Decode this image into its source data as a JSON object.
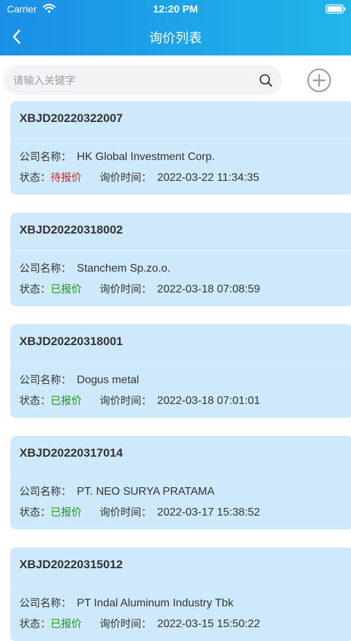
{
  "status_bar": {
    "carrier": "Carrier",
    "time": "12:20 PM"
  },
  "header": {
    "title": "询价列表"
  },
  "search": {
    "placeholder": "请输入关键字"
  },
  "labels": {
    "company": "公司名称：",
    "status": "状态：",
    "time": "询价时间："
  },
  "colors": {
    "pending": "#e02020",
    "quoted": "#1e9a1e",
    "card_bg": "#cde9fb"
  },
  "items": [
    {
      "id": "XBJD20220322007",
      "company": "HK Global Investment Corp.",
      "status": "待报价",
      "status_type": "pending",
      "time": "2022-03-22 11:34:35"
    },
    {
      "id": "XBJD20220318002",
      "company": "Stanchem Sp.zo.o.",
      "status": "已报价",
      "status_type": "quoted",
      "time": "2022-03-18 07:08:59"
    },
    {
      "id": "XBJD20220318001",
      "company": "Dogus metal",
      "status": "已报价",
      "status_type": "quoted",
      "time": "2022-03-18 07:01:01"
    },
    {
      "id": "XBJD20220317014",
      "company": "PT. NEO SURYA PRATAMA",
      "status": "已报价",
      "status_type": "quoted",
      "time": "2022-03-17 15:38:52"
    },
    {
      "id": "XBJD20220315012",
      "company": "PT Indal Aluminum Industry Tbk",
      "status": "已报价",
      "status_type": "quoted",
      "time": "2022-03-15 15:50:22"
    }
  ]
}
